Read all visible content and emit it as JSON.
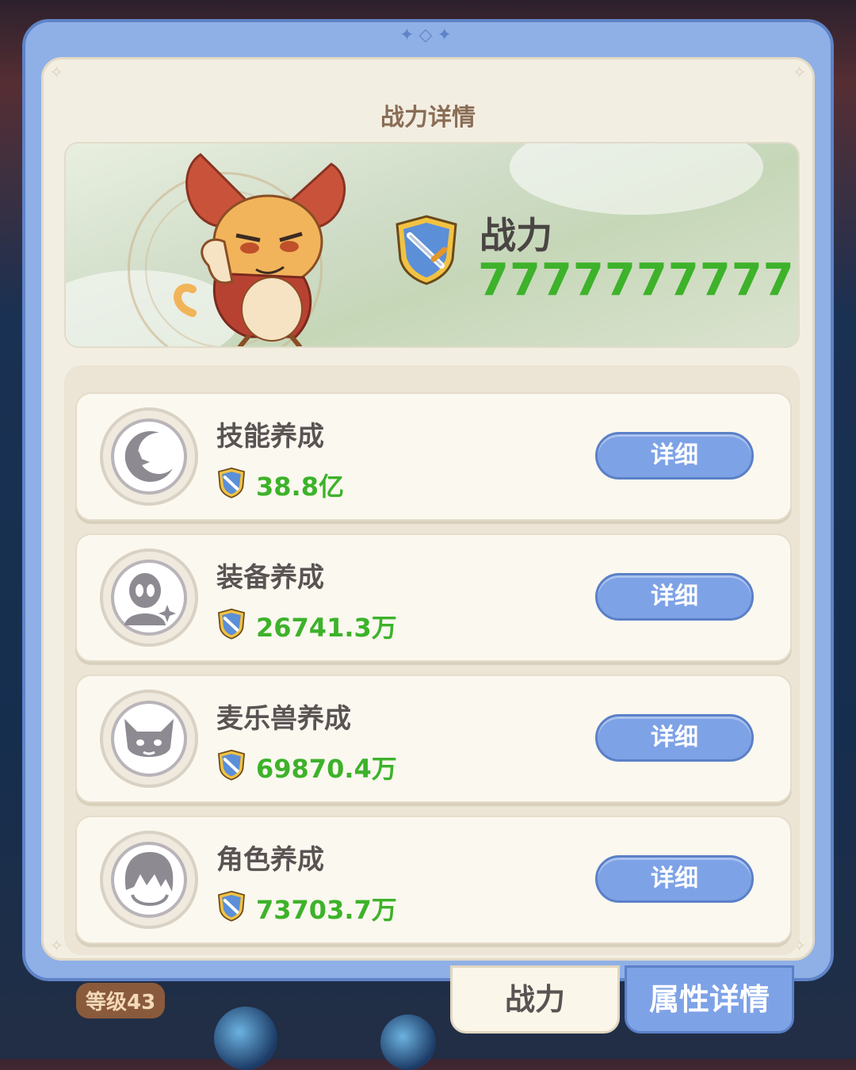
{
  "background": {
    "level_badge": "等级43"
  },
  "panel": {
    "title": "战力详情",
    "summary": {
      "label": "战力",
      "value": "7777777777"
    },
    "categories": [
      {
        "name": "技能养成",
        "value": "38.8亿",
        "button": "详细",
        "icon": "moon-sparkle-icon"
      },
      {
        "name": "装备养成",
        "value": "26741.3万",
        "button": "详细",
        "icon": "alien-head-icon"
      },
      {
        "name": "麦乐兽养成",
        "value": "69870.4万",
        "button": "详细",
        "icon": "cat-face-icon"
      },
      {
        "name": "角色养成",
        "value": "73703.7万",
        "button": "详细",
        "icon": "hair-head-icon"
      }
    ]
  },
  "tabs": [
    {
      "label": "战力",
      "active": true
    },
    {
      "label": "属性详情",
      "active": false
    }
  ],
  "colors": {
    "accent_blue": "#7ea2e6",
    "power_green": "#3db22a",
    "panel_cream": "#f3eee2"
  }
}
